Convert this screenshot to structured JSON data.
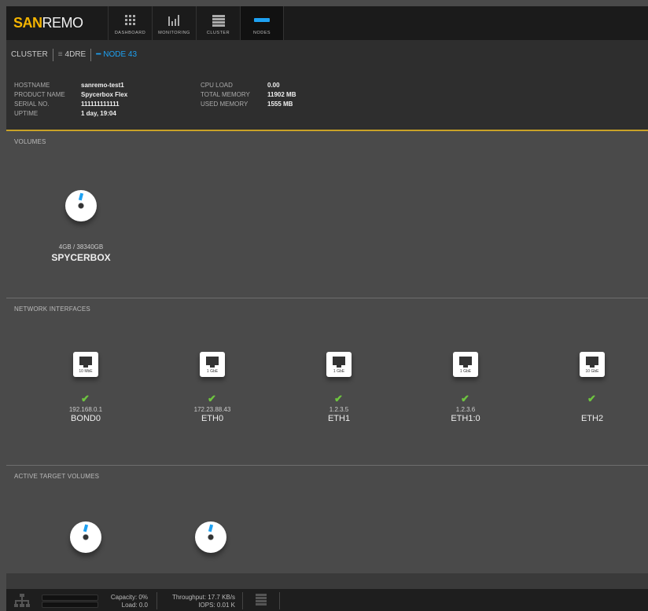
{
  "brand": {
    "part1": "SAN",
    "part2": "REMO"
  },
  "nav": [
    {
      "label": "DASHBOARD",
      "icon": "grid-icon",
      "active": false
    },
    {
      "label": "MONITORING",
      "icon": "bar-chart-icon",
      "active": false
    },
    {
      "label": "CLUSTER",
      "icon": "server-stack-icon",
      "active": false
    },
    {
      "label": "NODES",
      "icon": "node-icon",
      "active": true
    }
  ],
  "breadcrumb": {
    "cluster": "CLUSTER",
    "group": "4DRE",
    "node": "NODE 43"
  },
  "info": {
    "left": [
      {
        "key": "HOSTNAME",
        "value": "sanremo-test1"
      },
      {
        "key": "PRODUCT NAME",
        "value": "Spycerbox Flex"
      },
      {
        "key": "SERIAL NO.",
        "value": "111111111111"
      },
      {
        "key": "UPTIME",
        "value": "1 day, 19:04"
      }
    ],
    "right": [
      {
        "key": "CPU LOAD",
        "value": "0.00"
      },
      {
        "key": "TOTAL MEMORY",
        "value": "11902 MB"
      },
      {
        "key": "USED MEMORY",
        "value": "1555 MB"
      }
    ]
  },
  "volumes": {
    "title": "VOLUMES",
    "items": [
      {
        "size": "4GB / 38340GB",
        "name": "SPYCERBOX"
      }
    ]
  },
  "network": {
    "title": "NETWORK INTERFACES",
    "items": [
      {
        "speed": "10 MbE",
        "ip": "192.168.0.1",
        "name": "BOND0"
      },
      {
        "speed": "1 GbE",
        "ip": "172.23.88.43",
        "name": "ETH0"
      },
      {
        "speed": "1 GbE",
        "ip": "1.2.3.5",
        "name": "ETH1"
      },
      {
        "speed": "1 GbE",
        "ip": "1.2.3.6",
        "name": "ETH1:0"
      },
      {
        "speed": "10 GbE",
        "ip": "",
        "name": "ETH2"
      }
    ]
  },
  "targets": {
    "title": "ACTIVE TARGET VOLUMES"
  },
  "status": {
    "capacity": "Capacity: 0%",
    "load": "Load: 0.0",
    "throughput": "Throughput: 17.7 KB/s",
    "iops": "IOPS: 0.01 K"
  },
  "colors": {
    "accent": "#f4b400",
    "active": "#1ea1f2",
    "ok": "#6ec53f"
  }
}
